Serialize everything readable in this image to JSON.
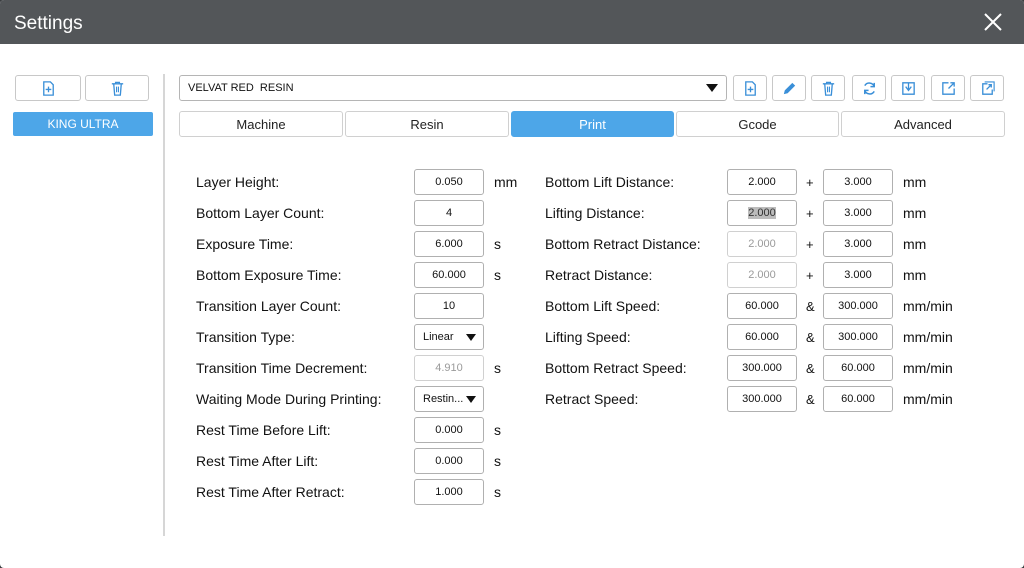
{
  "window": {
    "title": "Settings"
  },
  "machines": {
    "selected": "KING ULTRA"
  },
  "profile": {
    "selected": "VELVAT RED  RESIN"
  },
  "tabs": [
    "Machine",
    "Resin",
    "Print",
    "Gcode",
    "Advanced"
  ],
  "active_tab": "Print",
  "left_fields": [
    {
      "label": "Layer Height:",
      "value": "0.050",
      "unit": "mm",
      "disabled": false
    },
    {
      "label": "Bottom Layer Count:",
      "value": "4",
      "unit": "",
      "disabled": false
    },
    {
      "label": "Exposure Time:",
      "value": "6.000",
      "unit": "s",
      "disabled": false
    },
    {
      "label": "Bottom Exposure Time:",
      "value": "60.000",
      "unit": "s",
      "disabled": false
    },
    {
      "label": "Transition Layer Count:",
      "value": "10",
      "unit": "",
      "disabled": false
    },
    {
      "label": "Transition Type:",
      "value": "Linear",
      "unit": "",
      "disabled": false,
      "select": true
    },
    {
      "label": "Transition Time Decrement:",
      "value": "4.910",
      "unit": "s",
      "disabled": true
    },
    {
      "label": "Waiting Mode During Printing:",
      "value": "Restin...",
      "unit": "",
      "disabled": false,
      "select": true
    },
    {
      "label": "Rest Time Before Lift:",
      "value": "0.000",
      "unit": "s",
      "disabled": false
    },
    {
      "label": "Rest Time After Lift:",
      "value": "0.000",
      "unit": "s",
      "disabled": false
    },
    {
      "label": "Rest Time After Retract:",
      "value": "1.000",
      "unit": "s",
      "disabled": false
    }
  ],
  "right_fields": [
    {
      "label": "Bottom Lift Distance:",
      "value1": "2.000",
      "op": "+",
      "value2": "3.000",
      "unit": "mm",
      "disabled1": false
    },
    {
      "label": "Lifting Distance:",
      "value1": "2.000",
      "op": "+",
      "value2": "3.000",
      "unit": "mm",
      "disabled1": false,
      "highlight1": true
    },
    {
      "label": "Bottom Retract Distance:",
      "value1": "2.000",
      "op": "+",
      "value2": "3.000",
      "unit": "mm",
      "disabled1": true
    },
    {
      "label": "Retract Distance:",
      "value1": "2.000",
      "op": "+",
      "value2": "3.000",
      "unit": "mm",
      "disabled1": true
    },
    {
      "label": "Bottom Lift Speed:",
      "value1": "60.000",
      "op": "&",
      "value2": "300.000",
      "unit": "mm/min",
      "disabled1": false
    },
    {
      "label": "Lifting Speed:",
      "value1": "60.000",
      "op": "&",
      "value2": "300.000",
      "unit": "mm/min",
      "disabled1": false
    },
    {
      "label": "Bottom Retract Speed:",
      "value1": "300.000",
      "op": "&",
      "value2": "60.000",
      "unit": "mm/min",
      "disabled1": false
    },
    {
      "label": "Retract Speed:",
      "value1": "300.000",
      "op": "&",
      "value2": "60.000",
      "unit": "mm/min",
      "disabled1": false
    }
  ],
  "colors": {
    "accent": "#4da6e8",
    "titlebar": "#535659",
    "icon_blue": "#3a8fd8"
  },
  "icons": {
    "left_toolbar": [
      "add-file-icon",
      "trash-icon"
    ],
    "right_toolbar": [
      "add-file-icon",
      "pencil-icon",
      "trash-icon",
      "refresh-icon",
      "import-icon",
      "export-icon",
      "export-all-icon"
    ]
  }
}
